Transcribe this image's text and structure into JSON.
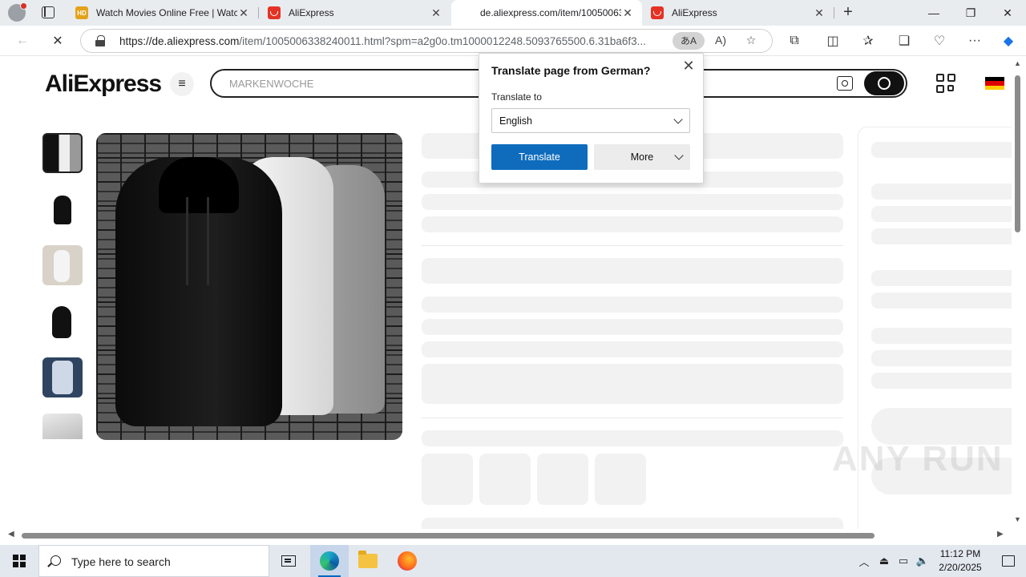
{
  "browser": {
    "tabs": [
      {
        "label": "Watch Movies Online Free | Watc",
        "favicon": "hd-icon",
        "active": false
      },
      {
        "label": "AliExpress",
        "favicon": "aliexpress-icon",
        "active": false
      },
      {
        "label": "de.aliexpress.com/item/10050063",
        "favicon": "loading-icon",
        "active": true
      },
      {
        "label": "AliExpress",
        "favicon": "aliexpress-icon",
        "active": false
      }
    ],
    "new_tab": "+",
    "window_controls": {
      "minimize": "—",
      "restore": "❐",
      "close": "✕"
    },
    "address": {
      "url_host": "https://de.aliexpress.com",
      "url_path": "/item/1005006338240011.html?spm=a2g0o.tm1000012248.5093765500.6.31ba6f3...",
      "translate_pill": "あA"
    },
    "nav": {
      "back": "←",
      "stop": "✕",
      "more": "···"
    }
  },
  "page": {
    "logo": {
      "ali": "AliExpress"
    },
    "search": {
      "placeholder": "MARKENWOCHE"
    },
    "flag_colors": [
      "#000000",
      "#dd0000",
      "#ffce00"
    ]
  },
  "translate_popup": {
    "title": "Translate page from German?",
    "translate_to_label": "Translate to",
    "selected_language": "English",
    "translate_button": "Translate",
    "more_button": "More",
    "close": "✕"
  },
  "watermark": "ANY RUN",
  "taskbar": {
    "search_placeholder": "Type here to search",
    "time": "11:12 PM",
    "date": "2/20/2025"
  },
  "colors": {
    "accent_blue": "#0f6cbd",
    "ali_red": "#e43225",
    "ali_orange": "#ff6a00"
  }
}
